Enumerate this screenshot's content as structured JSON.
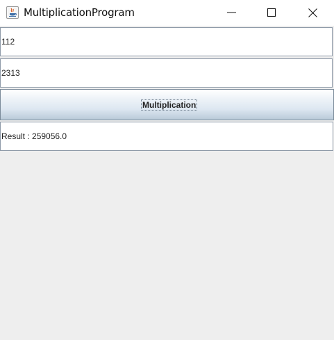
{
  "window": {
    "title": "MultiplicationProgram",
    "icon": "java-icon",
    "controls": [
      "minimize-icon",
      "maximize-icon",
      "close-icon"
    ]
  },
  "inputs": {
    "first_value": "112",
    "second_value": "2313"
  },
  "button": {
    "label": "Multiplication"
  },
  "result": {
    "text": "Result : 259056.0"
  },
  "colors": {
    "background": "#eeeeee",
    "field_border": "#8e9aa8",
    "button_gradient_bottom": "#b9cad9"
  }
}
